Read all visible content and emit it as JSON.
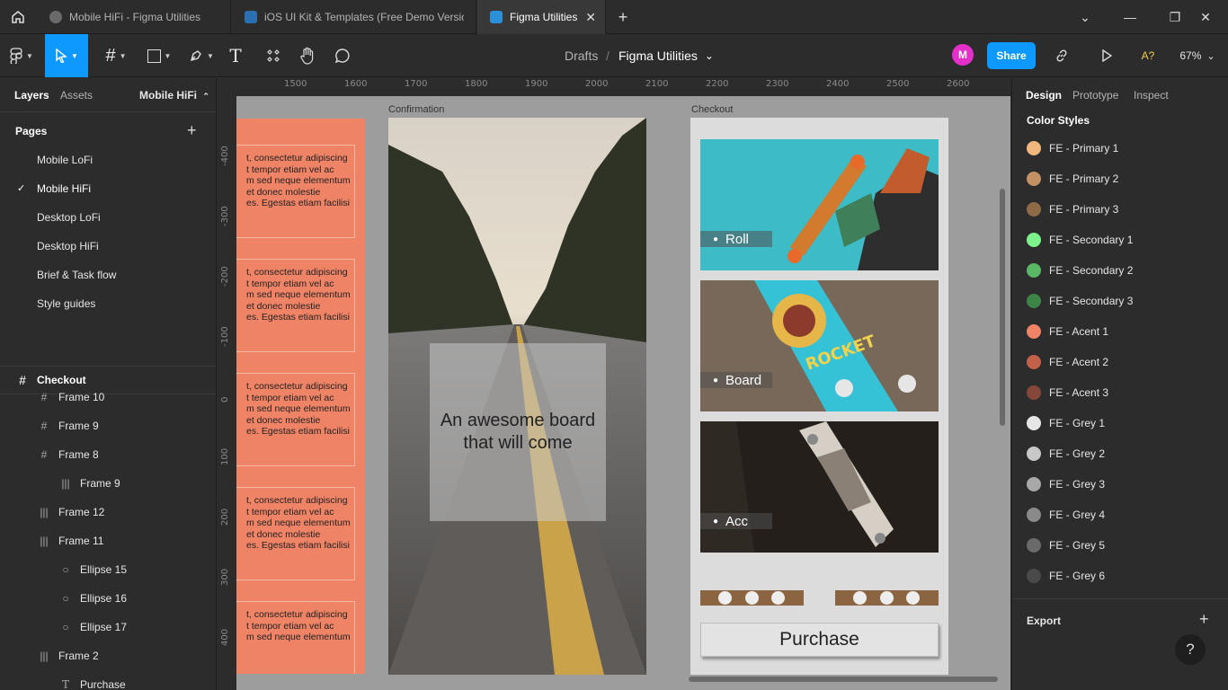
{
  "tabs": [
    {
      "label": "Mobile HiFi - Figma Utilities"
    },
    {
      "label": "iOS UI Kit & Templates (Free Demo Version)"
    },
    {
      "label": "Figma Utilities"
    }
  ],
  "toolbar": {
    "breadcrumb_parent": "Drafts",
    "breadcrumb_sep": "/",
    "file_name": "Figma Utilities",
    "avatar_initial": "M",
    "share_label": "Share",
    "font_warning": "A?",
    "zoom": "67%"
  },
  "left_panel": {
    "tab_layers": "Layers",
    "tab_assets": "Assets",
    "page_selector": "Mobile HiFi",
    "pages_title": "Pages",
    "pages": [
      "Mobile LoFi",
      "Mobile HiFi",
      "Desktop LoFi",
      "Desktop HiFi",
      "Brief & Task flow",
      "Style guides"
    ],
    "current_frame": "Checkout",
    "layers": [
      {
        "label": "Frame 10",
        "icon": "frame"
      },
      {
        "label": "Frame 9",
        "icon": "frame"
      },
      {
        "label": "Frame 8",
        "icon": "frame"
      },
      {
        "label": "Frame 9",
        "icon": "autolayout"
      },
      {
        "label": "Frame 12",
        "icon": "autolayout"
      },
      {
        "label": "Frame 11",
        "icon": "autolayout"
      },
      {
        "label": "Ellipse 15",
        "icon": "ellipse"
      },
      {
        "label": "Ellipse 16",
        "icon": "ellipse"
      },
      {
        "label": "Ellipse 17",
        "icon": "ellipse"
      },
      {
        "label": "Frame 2",
        "icon": "autolayout"
      },
      {
        "label": "Purchase",
        "icon": "text"
      }
    ]
  },
  "canvas": {
    "ruler_top": [
      "1500",
      "1600",
      "1700",
      "1800",
      "1900",
      "2000",
      "2100",
      "2200",
      "2300",
      "2400",
      "2500",
      "2600"
    ],
    "ruler_left": [
      "-400",
      "-300",
      "-200",
      "-100",
      "0",
      "100",
      "200",
      "300",
      "400"
    ],
    "frame_confirmation": "Confirmation",
    "frame_checkout": "Checkout",
    "lorem_lines": [
      "t, consectetur adipiscing",
      "t tempor etiam vel ac",
      "m sed neque elementum",
      "et donec molestie",
      "es. Egestas etiam facilisi"
    ],
    "confirm_text_line1": "An awesome board",
    "confirm_text_line2": "that will come",
    "checkout_items": [
      "Roll",
      "Board",
      "Acc"
    ],
    "purchase_label": "Purchase",
    "skateboard_text": "ROCKET"
  },
  "right_panel": {
    "tab_design": "Design",
    "tab_prototype": "Prototype",
    "tab_inspect": "Inspect",
    "color_styles_title": "Color Styles",
    "color_styles": [
      {
        "name": "FE - Primary 1",
        "color": "#f2b77c"
      },
      {
        "name": "FE - Primary 2",
        "color": "#c49262"
      },
      {
        "name": "FE - Primary 3",
        "color": "#8f6a47"
      },
      {
        "name": "FE - Secondary 1",
        "color": "#7ef28a"
      },
      {
        "name": "FE - Secondary 2",
        "color": "#58b865"
      },
      {
        "name": "FE - Secondary 3",
        "color": "#3d8547"
      },
      {
        "name": "FE - Acent 1",
        "color": "#ef8366"
      },
      {
        "name": "FE - Acent 2",
        "color": "#c2604a"
      },
      {
        "name": "FE - Acent 3",
        "color": "#86463a"
      },
      {
        "name": "FE - Grey 1",
        "color": "#e6e6e6"
      },
      {
        "name": "FE - Grey 2",
        "color": "#c8c8c8"
      },
      {
        "name": "FE - Grey 3",
        "color": "#a8a8a8"
      },
      {
        "name": "FE - Grey 4",
        "color": "#8a8a8a"
      },
      {
        "name": "FE - Grey 5",
        "color": "#6a6a6a"
      },
      {
        "name": "FE - Grey 6",
        "color": "#4a4a4a"
      }
    ],
    "export_title": "Export",
    "help_label": "?"
  }
}
